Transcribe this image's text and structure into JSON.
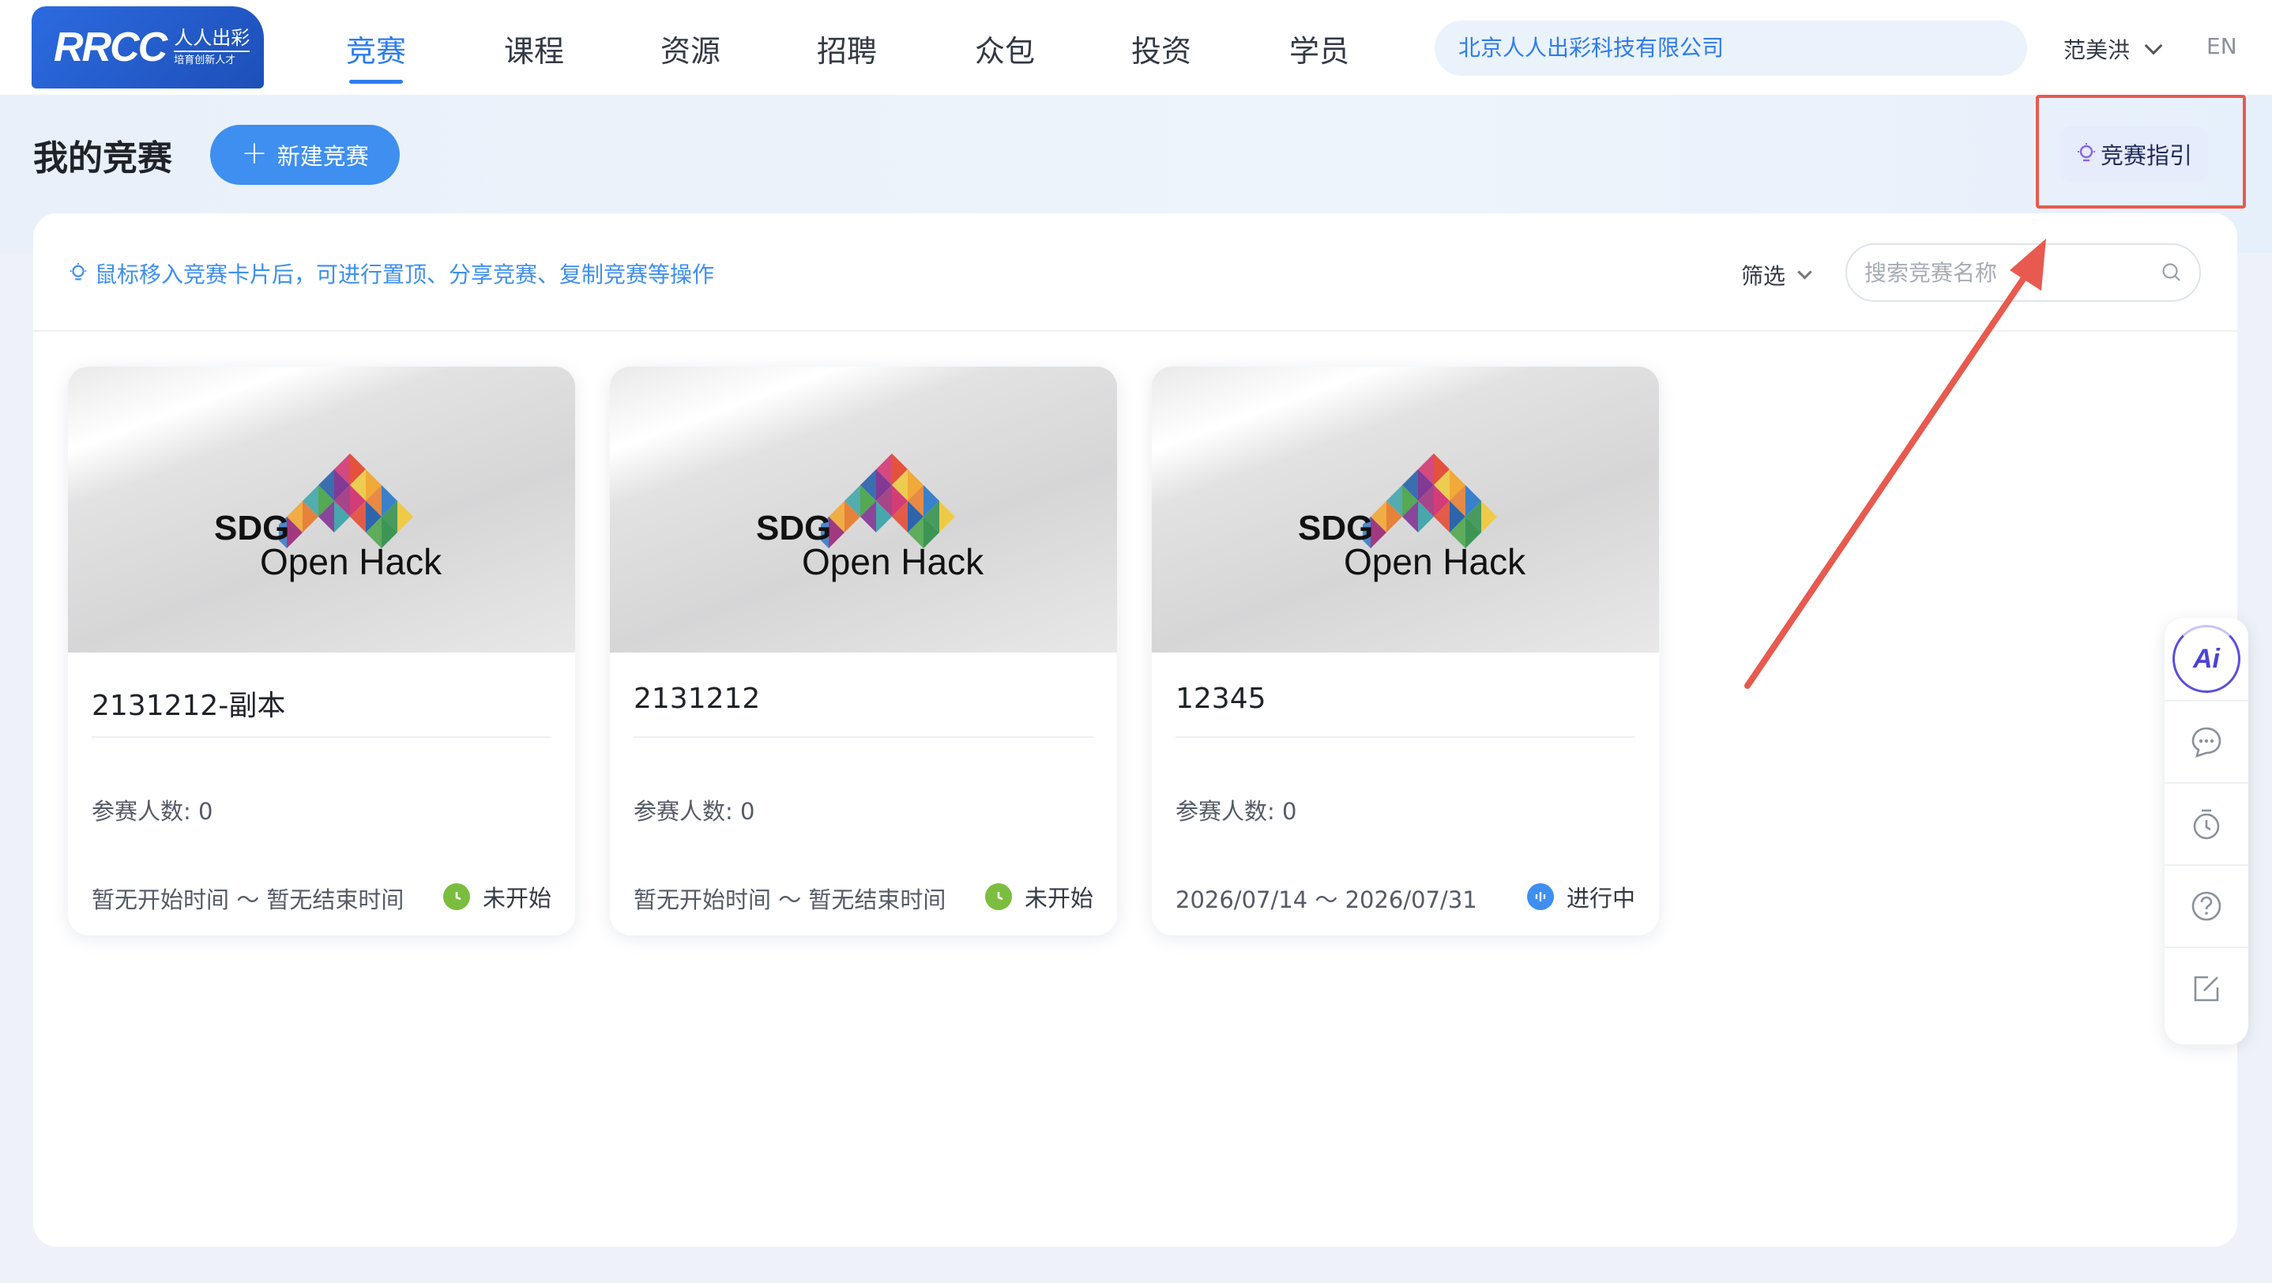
{
  "brand": {
    "logo_text": "RRCC",
    "logo_cn": "人人出彩",
    "logo_slogan": "培育创新人才"
  },
  "nav": {
    "items": [
      "竞赛",
      "课程",
      "资源",
      "招聘",
      "众包",
      "投资",
      "学员"
    ],
    "active": "竞赛",
    "org_name": "北京人人出彩科技有限公司",
    "user_name": "范美洪",
    "lang": "EN"
  },
  "page": {
    "title": "我的竞赛",
    "new_button": "新建竞赛",
    "guide_button": "竞赛指引"
  },
  "toolbar": {
    "tip": "鼠标移入竞赛卡片后，可进行置顶、分享竞赛、复制竞赛等操作",
    "filter_label": "筛选",
    "search_placeholder": "搜索竞赛名称"
  },
  "cover": {
    "sdg": "SDG",
    "hack": "Open Hack"
  },
  "count_label": "参赛人数:",
  "cards": [
    {
      "name": "2131212-副本",
      "count": "0",
      "time": "暂无开始时间 ～ 暂无结束时间",
      "status": "未开始",
      "status_color": "#7bbd3f",
      "status_icon": "clock-icon"
    },
    {
      "name": "2131212",
      "count": "0",
      "time": "暂无开始时间 ～ 暂无结束时间",
      "status": "未开始",
      "status_color": "#7bbd3f",
      "status_icon": "clock-icon"
    },
    {
      "name": "12345",
      "count": "0",
      "time": "2026/07/14 ～ 2026/07/31",
      "status": "进行中",
      "status_color": "#3e8ff0",
      "status_icon": "progress-icon"
    }
  ],
  "float_bar": {
    "ai_label": "Ai",
    "icons": [
      "ai-assistant-icon",
      "chat-icon",
      "timer-icon",
      "help-icon",
      "edit-icon"
    ]
  },
  "colors": {
    "primary": "#3e8ff0",
    "highlight": "#e85a4f",
    "pending": "#7bbd3f"
  }
}
